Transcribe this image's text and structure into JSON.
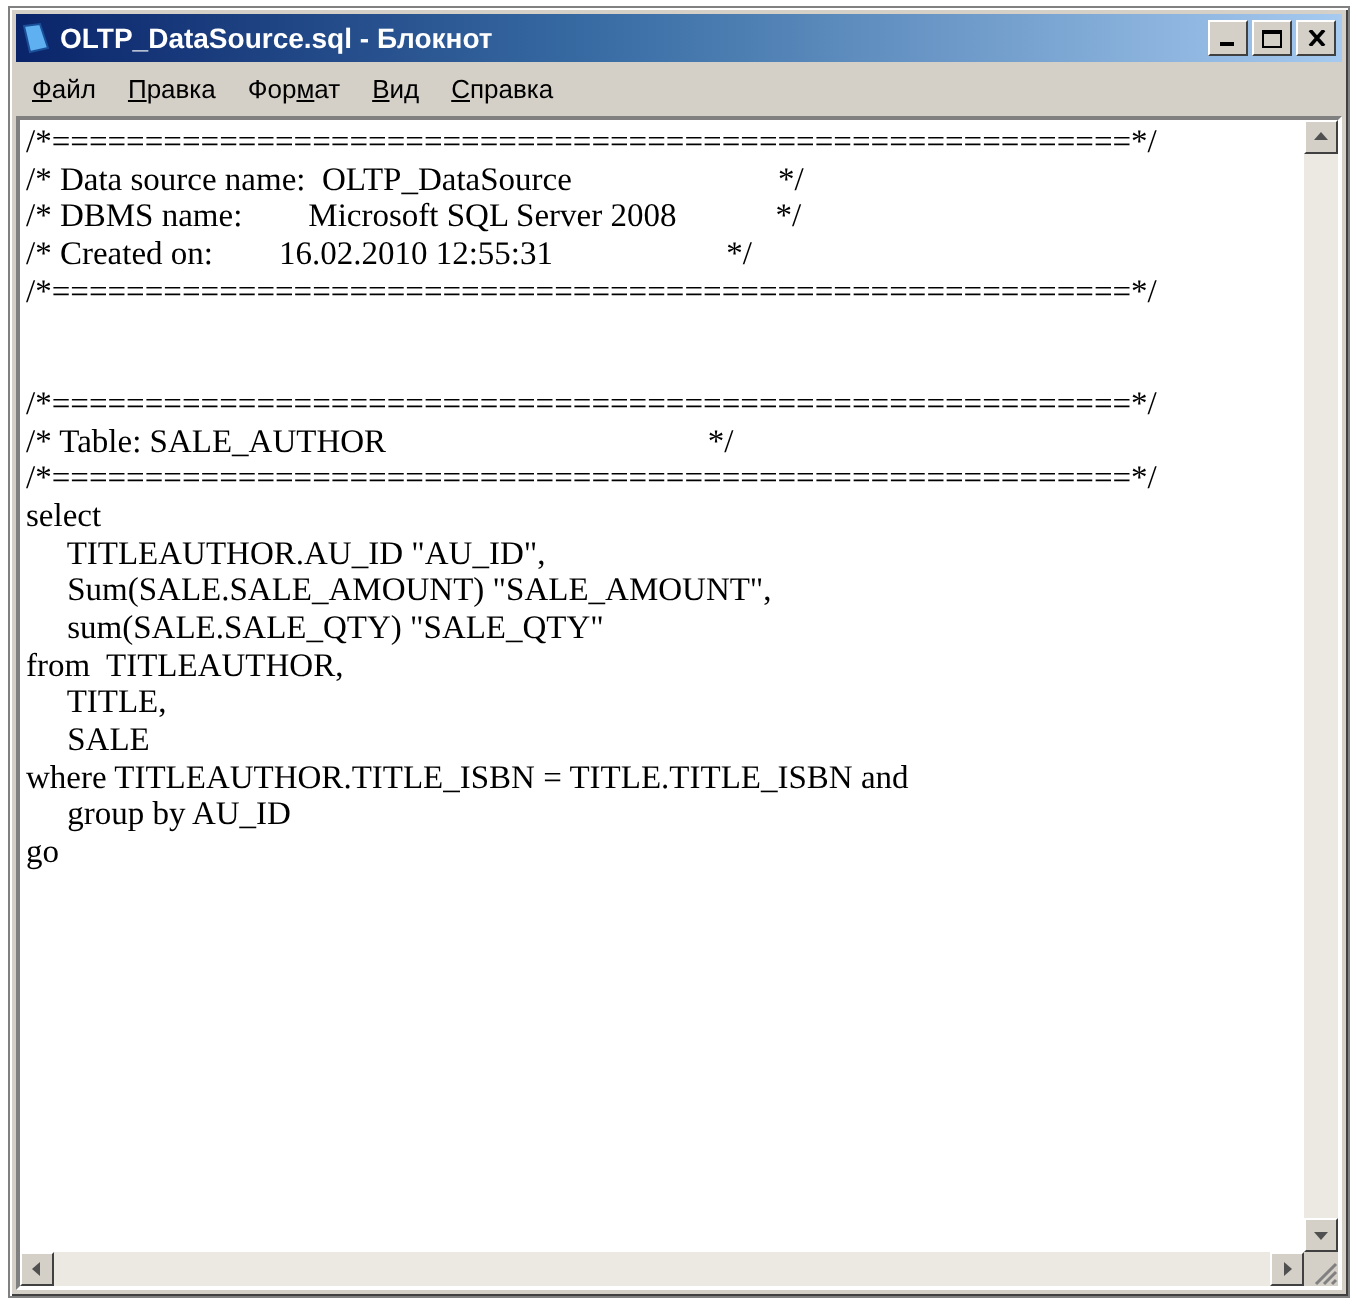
{
  "window": {
    "title": "OLTP_DataSource.sql - Блокнот"
  },
  "menu": [
    {
      "key": "Ф",
      "rest": "айл"
    },
    {
      "key": "П",
      "rest": "равка"
    },
    {
      "key": "м",
      "rest": "ат",
      "before": "Фор"
    },
    {
      "key": "В",
      "rest": "ид"
    },
    {
      "key": "С",
      "rest": "правка"
    }
  ],
  "blocks": [
    {
      "lines": [
        "/*==========================================================*/",
        "/* Data source name:  OLTP_DataSource                         */",
        "/* DBMS name:        Microsoft SQL Server 2008            */",
        "/* Created on:        16.02.2010 12:55:31                     */",
        "/*==========================================================*/"
      ]
    },
    {
      "lines": [
        "/*==========================================================*/",
        "/* Table: SALE_AUTHOR                                       */",
        "/*==========================================================*/",
        "select",
        "     TITLEAUTHOR.AU_ID \"AU_ID\",",
        "     Sum(SALE.SALE_AMOUNT) \"SALE_AMOUNT\",",
        "     sum(SALE.SALE_QTY) \"SALE_QTY\"",
        "from  TITLEAUTHOR,",
        "     TITLE,",
        "     SALE",
        "where TITLEAUTHOR.TITLE_ISBN = TITLE.TITLE_ISBN and",
        "     group by AU_ID",
        "go"
      ]
    }
  ]
}
